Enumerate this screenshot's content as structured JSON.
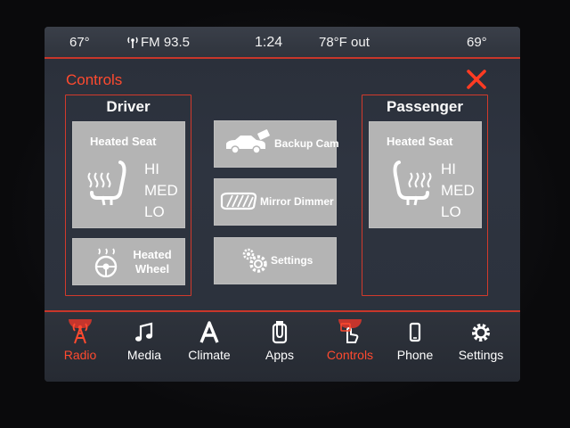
{
  "status": {
    "temp_left": "67°",
    "radio": "FM 93.5",
    "time": "1:24",
    "outside_temp": "78°F out",
    "temp_right": "69°"
  },
  "header": {
    "title": "Controls"
  },
  "driver": {
    "title": "Driver",
    "seat_label": "Heated Seat",
    "levels": [
      "HI",
      "MED",
      "LO"
    ],
    "wheel_label_line1": "Heated",
    "wheel_label_line2": "Wheel"
  },
  "passenger": {
    "title": "Passenger",
    "seat_label": "Heated Seat",
    "levels": [
      "HI",
      "MED",
      "LO"
    ]
  },
  "center_buttons": {
    "backup_cam": "Backup Cam",
    "mirror_dimmer": "Mirror Dimmer",
    "settings": "Settings"
  },
  "nav": {
    "items": [
      {
        "label": "Radio",
        "icon": "radio-tower-icon",
        "active": true
      },
      {
        "label": "Media",
        "icon": "music-note-icon",
        "active": false
      },
      {
        "label": "Climate",
        "icon": "climate-a-icon",
        "active": false
      },
      {
        "label": "Apps",
        "icon": "apps-icon",
        "active": false
      },
      {
        "label": "Controls",
        "icon": "controls-hand-icon",
        "active": true
      },
      {
        "label": "Phone",
        "icon": "phone-icon",
        "active": false
      },
      {
        "label": "Settings",
        "icon": "gear-icon",
        "active": false
      }
    ]
  },
  "colors": {
    "accent": "#ff4a2f",
    "panel_border": "#d23a2c",
    "button_bg": "#b4b4b4"
  }
}
